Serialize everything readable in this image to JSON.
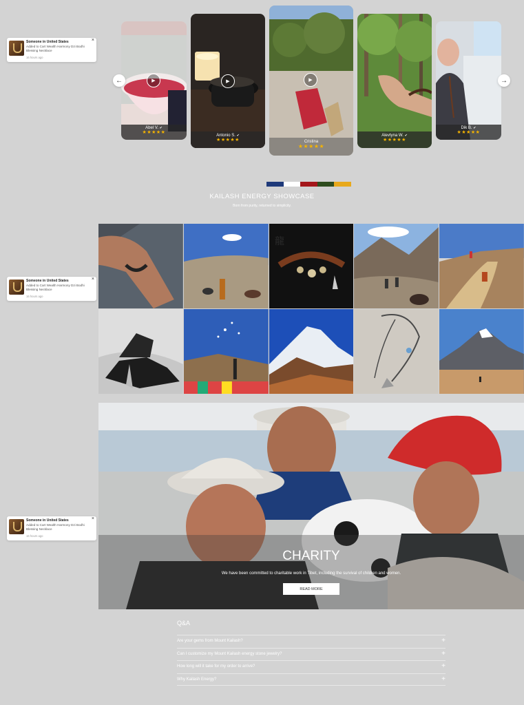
{
  "notifications": [
    {
      "title": "Someone in United States",
      "text": "Added to Cart Wealth Harmony Dzi Bodhi Blessing Necklace",
      "time": "16 hours ago"
    },
    {
      "title": "Someone in United States",
      "text": "Added to Cart Wealth Harmony Dzi Bodhi Blessing Necklace",
      "time": "16 hours ago"
    },
    {
      "title": "Someone in United States",
      "text": "Added to Cart Wealth Harmony Dzi Bodhi Blessing Necklace",
      "time": "16 hours ago"
    }
  ],
  "close_glyph": "×",
  "carousel": {
    "prev_glyph": "←",
    "next_glyph": "→",
    "play_glyph": "▶",
    "verified_glyph": "✔",
    "reviews": [
      {
        "name": "Abel V.",
        "stars": "★★★★★",
        "rating": 5,
        "has_play": true
      },
      {
        "name": "Antonio S.",
        "stars": "★★★★★",
        "rating": 5,
        "has_play": true
      },
      {
        "name": "Cristina",
        "stars": "★★★★★",
        "rating": 5,
        "has_play": true
      },
      {
        "name": "Alevtyna W.",
        "stars": "★★★★★",
        "rating": 5,
        "has_play": false
      },
      {
        "name": "Dik B.",
        "stars": "★★★★★",
        "rating": 5,
        "has_play": false
      }
    ]
  },
  "showcase": {
    "colors": [
      "#1f3a7a",
      "#ffffff",
      "#a4161a",
      "#2e4d1f",
      "#e8a91c"
    ],
    "title": "KAILASH ENERGY SHOWCASE",
    "subtitle": "Born from purity, returned to simplicity."
  },
  "charity": {
    "title": "CHARITY",
    "text": "We have been committed to charitable work in Tibet, including the survival of children and women.",
    "button": "READ MORE"
  },
  "qa": {
    "title": "Q&A",
    "plus_glyph": "+",
    "items": [
      "Are your gems from Mount Kailash?",
      "Can I customize my Mount Kailash energy stone jewelry?",
      "How long will it take for my order to arrive?",
      "Why Kailash Energy?"
    ]
  }
}
